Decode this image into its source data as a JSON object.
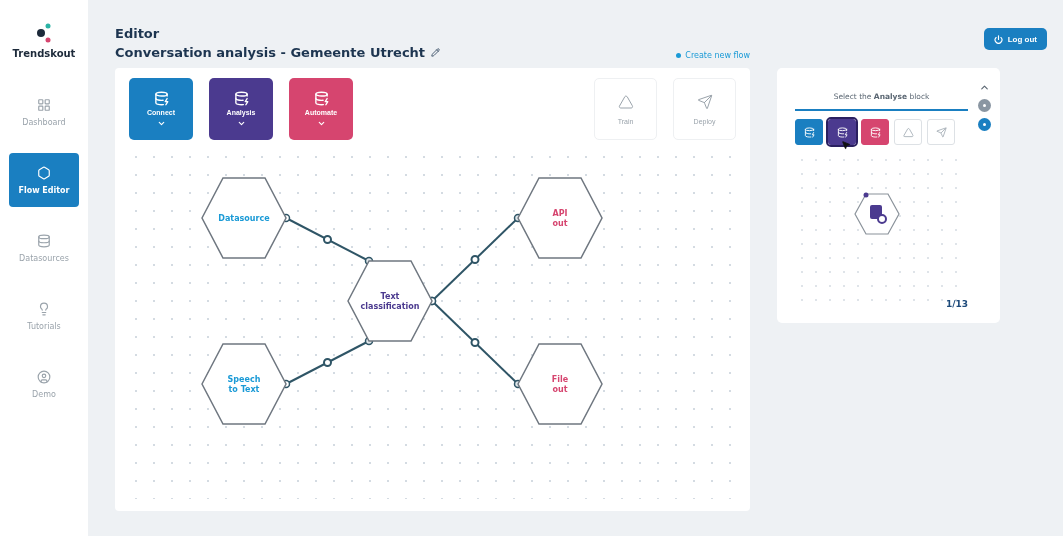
{
  "brand": {
    "name": "Trendskout"
  },
  "sidebar": {
    "items": [
      {
        "label": "Dashboard",
        "selected": false
      },
      {
        "label": "Flow Editor",
        "selected": true
      },
      {
        "label": "Datasources",
        "selected": false
      },
      {
        "label": "Tutorials",
        "selected": false
      },
      {
        "label": "Demo",
        "selected": false
      }
    ]
  },
  "header": {
    "title": "Editor",
    "subtitle": "Conversation analysis - Gemeente Utrecht",
    "create_link": "Create new flow",
    "logout": "Log out"
  },
  "toolbar": {
    "blocks": [
      {
        "label": "Connect",
        "color": "#1a7fc1",
        "disabled": false
      },
      {
        "label": "Analysis",
        "color": "#4b3a8f",
        "disabled": false
      },
      {
        "label": "Automate",
        "color": "#d6456f",
        "disabled": false
      }
    ],
    "actions": [
      {
        "label": "Train",
        "disabled": true
      },
      {
        "label": "Deploy",
        "disabled": true
      }
    ]
  },
  "flow": {
    "inputs": [
      {
        "label": "Datasource",
        "color": "#1a9ad6"
      },
      {
        "label": "Speech to Text",
        "color": "#1a9ad6"
      }
    ],
    "center": {
      "label": "Text classification",
      "color": "#4b3a8f"
    },
    "outputs": [
      {
        "label": "API out",
        "color": "#d6456f"
      },
      {
        "label": "File out",
        "color": "#d6456f"
      }
    ]
  },
  "tutorial": {
    "instruction": "Select the **Analyse** block",
    "blocks": [
      {
        "color": "#1a7fc1",
        "selected": false
      },
      {
        "color": "#4b3a8f",
        "selected": true
      },
      {
        "color": "#d6456f",
        "selected": false
      },
      {
        "color": "#ffffff",
        "selected": false
      },
      {
        "color": "#ffffff",
        "selected": false
      }
    ],
    "steps": [
      {
        "selected": false
      },
      {
        "selected": true
      }
    ],
    "counter": "1/13"
  }
}
